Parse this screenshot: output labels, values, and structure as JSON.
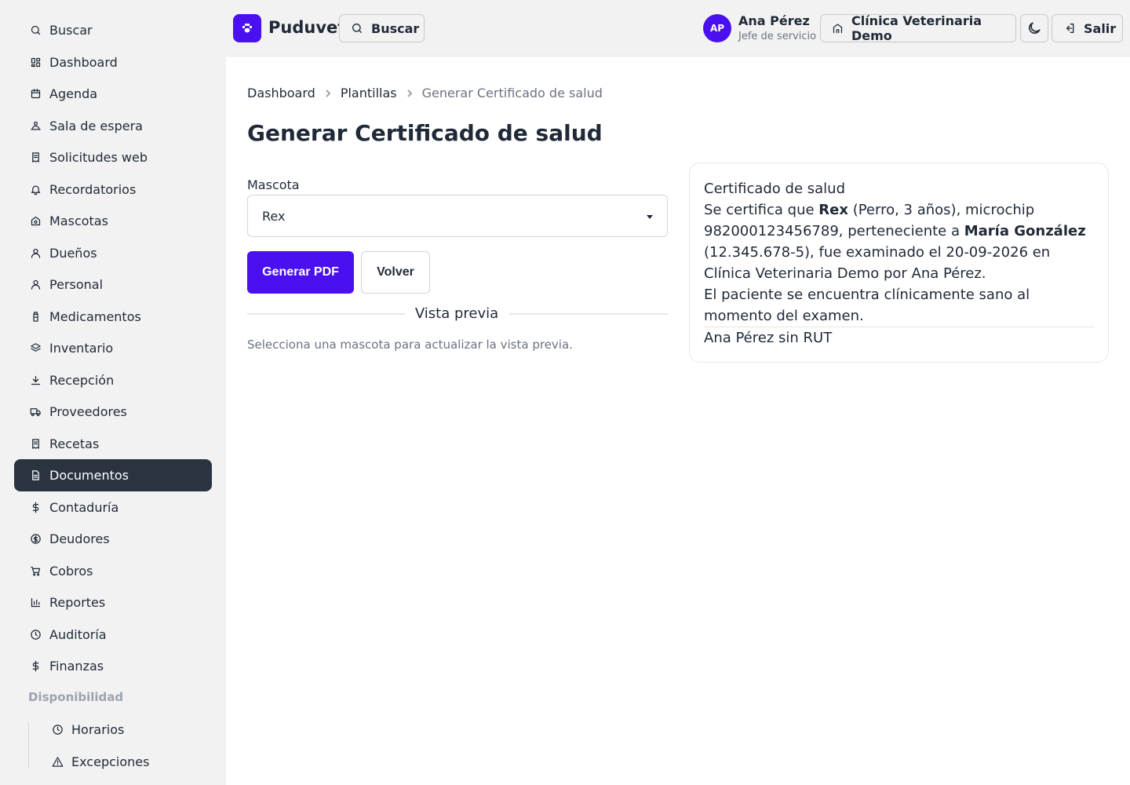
{
  "sidebar": {
    "items": [
      {
        "label": "Buscar",
        "icon": "search-icon"
      },
      {
        "label": "Dashboard",
        "icon": "dashboard-icon"
      },
      {
        "label": "Agenda",
        "icon": "calendar-icon"
      },
      {
        "label": "Sala de espera",
        "icon": "waiting-room-icon"
      },
      {
        "label": "Solicitudes web",
        "icon": "receipt-icon"
      },
      {
        "label": "Recordatorios",
        "icon": "bell-icon"
      },
      {
        "label": "Mascotas",
        "icon": "pet-house-icon"
      },
      {
        "label": "Dueños",
        "icon": "user-icon"
      },
      {
        "label": "Personal",
        "icon": "user-icon"
      },
      {
        "label": "Medicamentos",
        "icon": "medicine-icon"
      },
      {
        "label": "Inventario",
        "icon": "layers-icon"
      },
      {
        "label": "Recepción",
        "icon": "download-icon"
      },
      {
        "label": "Proveedores",
        "icon": "truck-icon"
      },
      {
        "label": "Recetas",
        "icon": "receipt-icon"
      },
      {
        "label": "Documentos",
        "icon": "document-icon"
      },
      {
        "label": "Contaduría",
        "icon": "dollar-icon"
      },
      {
        "label": "Deudores",
        "icon": "coin-icon"
      },
      {
        "label": "Cobros",
        "icon": "cart-icon"
      },
      {
        "label": "Reportes",
        "icon": "bar-chart-icon"
      },
      {
        "label": "Auditoría",
        "icon": "clock-icon"
      },
      {
        "label": "Finanzas",
        "icon": "dollar-icon"
      }
    ],
    "active_index": 14,
    "group_title": "Disponibilidad",
    "sub_items": [
      {
        "label": "Horarios",
        "icon": "clock-icon"
      },
      {
        "label": "Excepciones",
        "icon": "warning-icon"
      }
    ]
  },
  "header": {
    "brand": "Puduvet",
    "search_label": "Buscar",
    "avatar_initials": "AP",
    "user_name": "Ana Pérez",
    "user_role": "Jefe de servicio",
    "clinic_label": "Clínica Veterinaria Demo",
    "logout_label": "Salir"
  },
  "breadcrumb": {
    "items": [
      "Dashboard",
      "Plantillas",
      "Generar Certificado de salud"
    ]
  },
  "main": {
    "title": "Generar Certificado de salud",
    "pet_label": "Mascota",
    "pet_value": "Rex",
    "generate_label": "Generar PDF",
    "back_label": "Volver",
    "preview_divider": "Vista previa",
    "preview_hint": "Selecciona una mascota para actualizar la vista previa."
  },
  "preview": {
    "heading": "Certificado de salud",
    "t1": "Se certifica que ",
    "pet": "Rex",
    "t2": " (Perro, 3 años), microchip 982000123456789, perteneciente a ",
    "owner": "María González",
    "t3": " (12.345.678-5), fue examinado el 20-09-2026 en Clínica Veterinaria Demo por Ana Pérez.",
    "line2": "El paciente se encuentra clínicamente sano al momento del examen.",
    "signature": "Ana Pérez sin RUT"
  },
  "colors": {
    "accent": "#4a10f0",
    "sidebar_active": "#2a3441",
    "background_gray": "#f2f2f2"
  }
}
